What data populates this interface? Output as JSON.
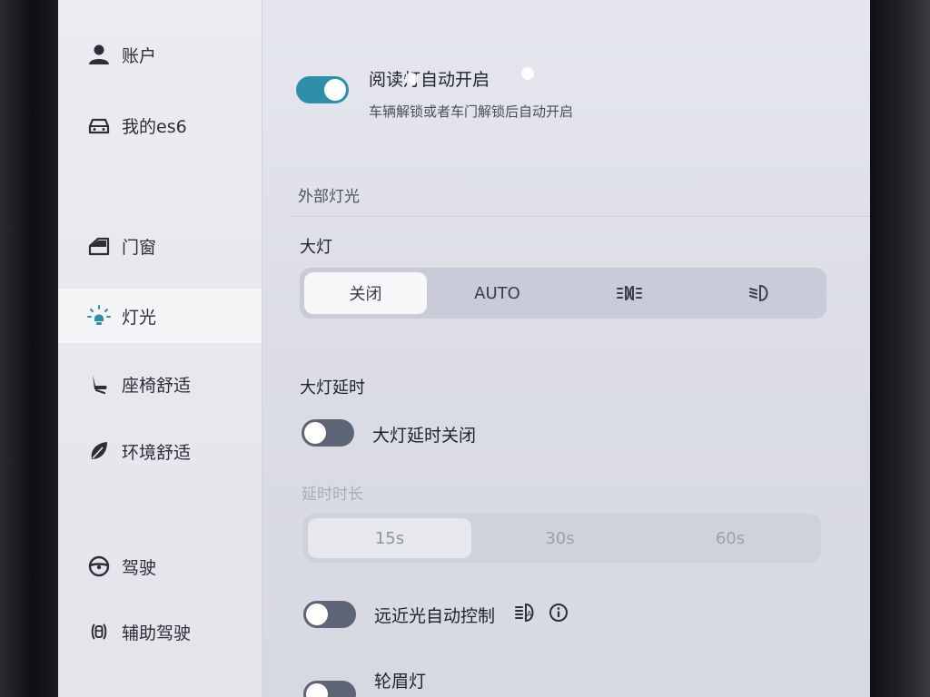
{
  "sidebar": {
    "items": [
      {
        "label": "账户",
        "icon": "person-icon"
      },
      {
        "label": "我的es6",
        "icon": "car-icon"
      },
      {
        "label": "门窗",
        "icon": "door-icon"
      },
      {
        "label": "灯光",
        "icon": "bulb-icon"
      },
      {
        "label": "座椅舒适",
        "icon": "seat-icon"
      },
      {
        "label": "环境舒适",
        "icon": "leaf-icon"
      },
      {
        "label": "驾驶",
        "icon": "steering-wheel-icon"
      },
      {
        "label": "辅助驾驶",
        "icon": "driver-assist-icon"
      }
    ],
    "active_index": 3
  },
  "main": {
    "reading_light": {
      "title": "阅读灯自动开启",
      "subtitle": "车辆解锁或者车门解锁后自动开启",
      "enabled": true
    },
    "exterior_section": "外部灯光",
    "headlight": {
      "label": "大灯",
      "options": [
        "关闭",
        "AUTO",
        "",
        ""
      ],
      "option_icons": [
        "",
        "",
        "parking-light-icon",
        "low-beam-icon"
      ],
      "selected_index": 0
    },
    "headlight_delay": {
      "label": "大灯延时",
      "toggle_title": "大灯延时关闭",
      "enabled": false
    },
    "delay_duration": {
      "label": "延时时长",
      "options": [
        "15s",
        "30s",
        "60s"
      ],
      "selected_index": 0
    },
    "auto_high_beam": {
      "title": "远近光自动控制",
      "enabled": false,
      "icon": "auto-high-beam-icon",
      "info_icon": "info-icon"
    },
    "eyebrow_light": {
      "title": "轮眉灯",
      "enabled": false
    }
  },
  "colors": {
    "accent": "#2f8fa8",
    "toggle_off": "#5d6475",
    "text_primary": "#1f2228",
    "text_dim": "#a7abb6"
  }
}
